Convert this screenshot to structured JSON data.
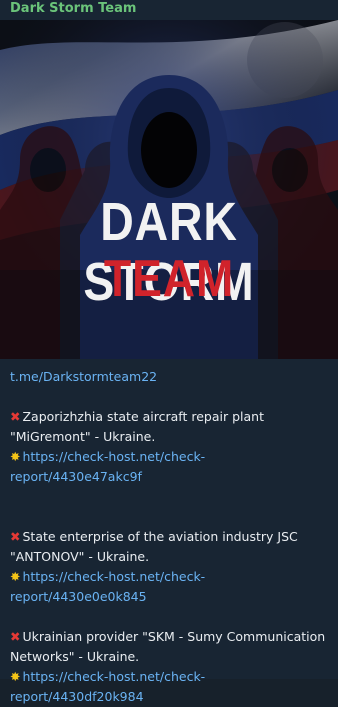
{
  "channel": {
    "name": "Dark Storm Team"
  },
  "poster": {
    "title_line1": "DARK STORM",
    "title_line2": "TEAM"
  },
  "message": {
    "channel_link": "t.me/Darkstormteam22",
    "posts": [
      {
        "target_line1": "Zaporizhzhia state aircraft repair plant",
        "target_line2": "\"MiGremont\" - Ukraine.",
        "link_line1": "https://check-host.net/check-",
        "link_line2": "report/4430e47akc9f"
      },
      {
        "target_line1": "State enterprise of the aviation industry JSC",
        "target_line2": "\"ANTONOV\" - Ukraine.",
        "link_line1": "https://check-host.net/check-",
        "link_line2": "report/4430e0e0k845"
      },
      {
        "target_line1": "Ukrainian provider \"SKM - Sumy Communication",
        "target_line2": "Networks\" - Ukraine.",
        "link_line1": "https://check-host.net/check-",
        "link_line2": "report/4430df20k984"
      }
    ]
  },
  "icons": {
    "cross": "cross-mark-icon",
    "star": "glowing-star-icon"
  },
  "colors": {
    "background": "#182533",
    "link": "#6ab3f3",
    "name": "#6bc47a",
    "accent_red": "#d0232b"
  }
}
